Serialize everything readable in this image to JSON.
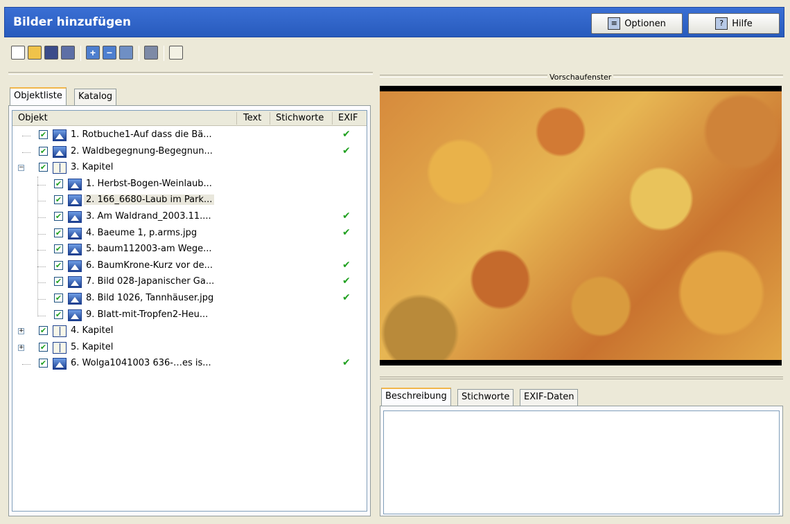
{
  "window": {
    "title": "Bilder hinzufügen"
  },
  "header_buttons": {
    "options": "Optionen",
    "help": "Hilfe"
  },
  "toolbar": {
    "icons": [
      "new-document-icon",
      "open-folder-icon",
      "save-icon",
      "save-as-icon",
      "add-icon",
      "remove-icon",
      "refresh-icon",
      "preview-eye-icon",
      "book-icon"
    ]
  },
  "left_tabs": {
    "objects": "Objektliste",
    "catalog": "Katalog"
  },
  "columns": {
    "object": "Objekt",
    "text": "Text",
    "keywords": "Stichworte",
    "exif": "EXIF"
  },
  "tree": [
    {
      "label": "1. Rotbuche1-Auf dass die Bä...",
      "type": "image",
      "level": 0,
      "exif": true,
      "checked": true
    },
    {
      "label": "2. Waldbegegnung-Begegnun...",
      "type": "image",
      "level": 0,
      "exif": true,
      "checked": true
    },
    {
      "label": "3. Kapitel",
      "type": "chapter",
      "level": 0,
      "exif": false,
      "checked": true,
      "expanded": true
    },
    {
      "label": "1. Herbst-Bogen-Weinlaub...",
      "type": "image",
      "level": 1,
      "exif": false,
      "checked": true
    },
    {
      "label": "2. 166_6680-Laub im Park...",
      "type": "image",
      "level": 1,
      "exif": false,
      "checked": true,
      "selected": true
    },
    {
      "label": "3. Am Waldrand_2003.11....",
      "type": "image",
      "level": 1,
      "exif": true,
      "checked": true
    },
    {
      "label": "4. Baeume 1, p.arms.jpg",
      "type": "image",
      "level": 1,
      "exif": true,
      "checked": true
    },
    {
      "label": "5. baum112003-am Wege...",
      "type": "image",
      "level": 1,
      "exif": false,
      "checked": true
    },
    {
      "label": "6. BaumKrone-Kurz vor de...",
      "type": "image",
      "level": 1,
      "exif": true,
      "checked": true
    },
    {
      "label": "7. Bild 028-Japanischer Ga...",
      "type": "image",
      "level": 1,
      "exif": true,
      "checked": true
    },
    {
      "label": "8. Bild 1026, Tannhäuser.jpg",
      "type": "image",
      "level": 1,
      "exif": true,
      "checked": true
    },
    {
      "label": "9. Blatt-mit-Tropfen2-Heu...",
      "type": "image",
      "level": 1,
      "exif": false,
      "checked": true
    },
    {
      "label": "4. Kapitel",
      "type": "chapter",
      "level": 0,
      "exif": false,
      "checked": true,
      "expanded": false
    },
    {
      "label": "5. Kapitel",
      "type": "chapter",
      "level": 0,
      "exif": false,
      "checked": true,
      "expanded": false
    },
    {
      "label": "6. Wolga1041003 636-…es is...",
      "type": "image",
      "level": 0,
      "exif": true,
      "checked": true
    }
  ],
  "preview": {
    "label": "Vorschaufenster"
  },
  "bottom_tabs": {
    "description": "Beschreibung",
    "keywords": "Stichworte",
    "exif": "EXIF-Daten"
  },
  "marks": {
    "check": "✔",
    "plus": "+",
    "minus": "−"
  }
}
